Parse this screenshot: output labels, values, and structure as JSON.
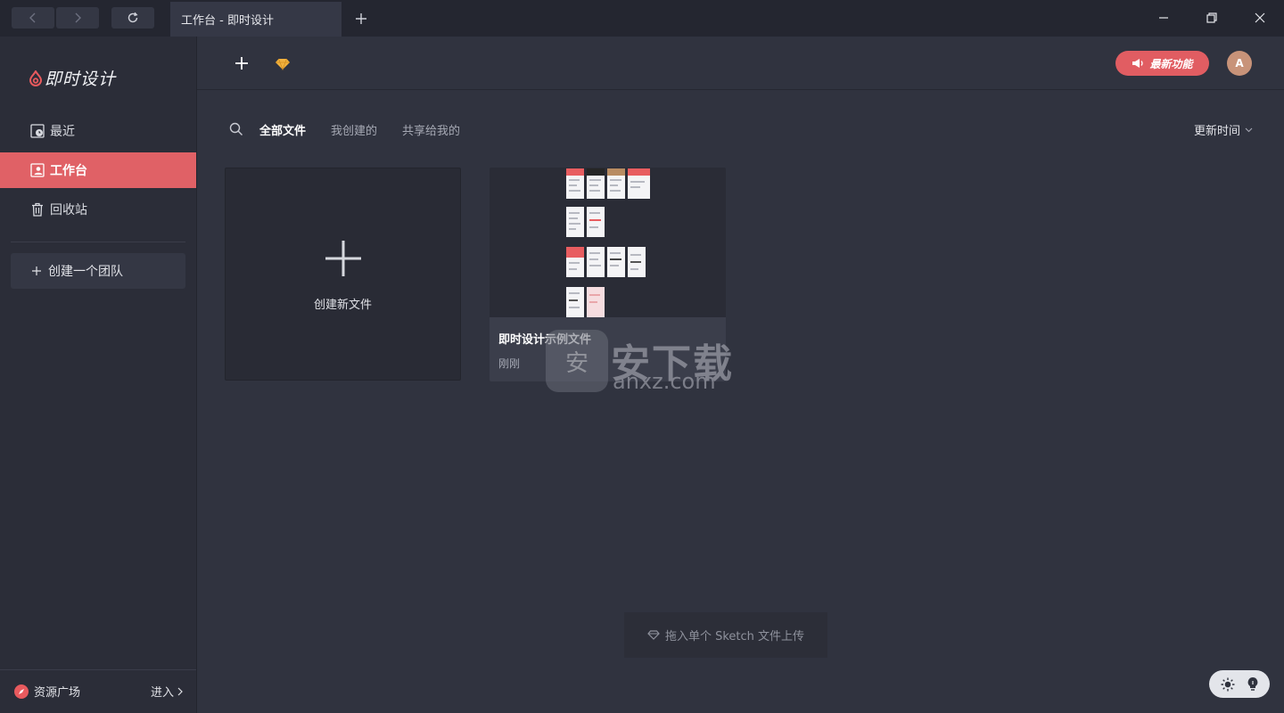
{
  "window": {
    "tab_title": "工作台 - 即时设计",
    "new_tab_icon": "plus-icon"
  },
  "app": {
    "name": "即时设计",
    "accent_color": "#e06166"
  },
  "sidebar": {
    "items": [
      {
        "label": "最近",
        "icon": "clock-icon",
        "active": false
      },
      {
        "label": "工作台",
        "icon": "workspace-icon",
        "active": true
      },
      {
        "label": "回收站",
        "icon": "trash-icon",
        "active": false
      }
    ],
    "create_team": "创建一个团队",
    "resources": "资源广场",
    "enter": "进入"
  },
  "toolbar": {
    "whats_new": "最新功能",
    "avatar_initial": "A"
  },
  "filters": {
    "tabs": [
      "全部文件",
      "我创建的",
      "共享给我的"
    ],
    "active_index": 0,
    "sort_label": "更新时间"
  },
  "cards": {
    "new_file_label": "创建新文件",
    "files": [
      {
        "name": "即时设计示例文件",
        "time": "刚刚"
      }
    ]
  },
  "watermark": {
    "title": "安下载",
    "sub": "anxz.com",
    "badge": "安"
  },
  "upload_hint": "拖入单个 Sketch 文件上传"
}
